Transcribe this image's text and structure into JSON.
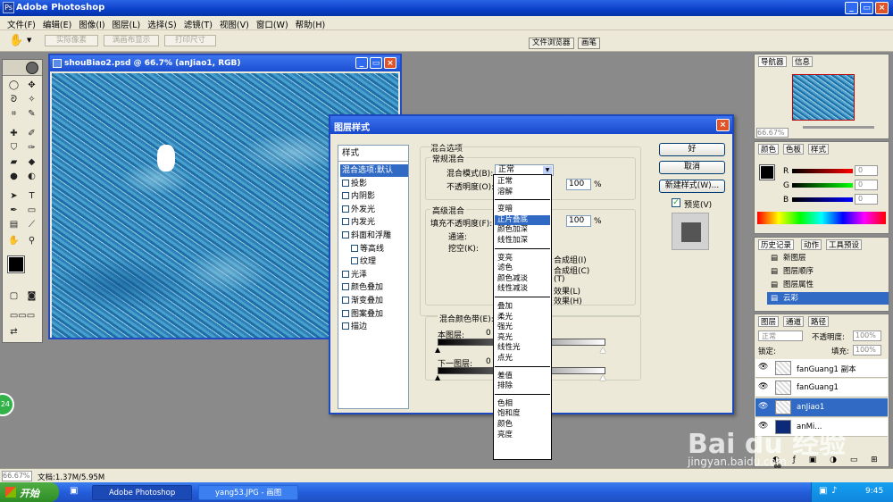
{
  "app": {
    "title": "Adobe Photoshop"
  },
  "menubar": [
    "文件(F)",
    "编辑(E)",
    "图像(I)",
    "图层(L)",
    "选择(S)",
    "滤镜(T)",
    "视图(V)",
    "窗口(W)",
    "帮助(H)"
  ],
  "options_bar": {
    "actual_pixels": "实际像素",
    "fit_screen": "满画布显示",
    "print_size": "打印尺寸",
    "file_browser_tab": "文件浏览器",
    "brushes_tab": "画笔"
  },
  "document": {
    "title": "shouBiao2.psd @ 66.7% (anJiao1, RGB)"
  },
  "dialog": {
    "title": "图层样式",
    "styles_header": "样式",
    "styles": [
      {
        "label": "混合选项:默认",
        "checkbox": false,
        "selected": true,
        "indent": false
      },
      {
        "label": "投影",
        "checkbox": true,
        "selected": false,
        "indent": false
      },
      {
        "label": "内阴影",
        "checkbox": true,
        "selected": false,
        "indent": false
      },
      {
        "label": "外发光",
        "checkbox": true,
        "selected": false,
        "indent": false
      },
      {
        "label": "内发光",
        "checkbox": true,
        "selected": false,
        "indent": false
      },
      {
        "label": "斜面和浮雕",
        "checkbox": true,
        "selected": false,
        "indent": false
      },
      {
        "label": "等高线",
        "checkbox": true,
        "selected": false,
        "indent": true
      },
      {
        "label": "纹理",
        "checkbox": true,
        "selected": false,
        "indent": true
      },
      {
        "label": "光泽",
        "checkbox": true,
        "selected": false,
        "indent": false
      },
      {
        "label": "颜色叠加",
        "checkbox": true,
        "selected": false,
        "indent": false
      },
      {
        "label": "渐变叠加",
        "checkbox": true,
        "selected": false,
        "indent": false
      },
      {
        "label": "图案叠加",
        "checkbox": true,
        "selected": false,
        "indent": false
      },
      {
        "label": "描边",
        "checkbox": true,
        "selected": false,
        "indent": false
      }
    ],
    "blend_options": {
      "group_title": "混合选项",
      "general_title": "常规混合",
      "mode_label": "混合模式(B):",
      "mode_value": "正常",
      "opacity_label": "不透明度(O):",
      "opacity_value": "100",
      "percent": "%",
      "advanced_title": "高级混合",
      "fill_opacity_label": "填充不透明度(F):",
      "fill_opacity_value": "100",
      "channels_label": "通道:",
      "knockout_label": "挖空(K):",
      "adv_options": [
        "合成组(I)",
        "合成组(C)",
        "(T)",
        "效果(L)",
        "效果(H)"
      ],
      "blend_if_label": "混合颜色带(E):",
      "this_layer_label": "本图层:",
      "this_layer_value": "0",
      "underlying_label": "下一图层:",
      "underlying_value": "0"
    },
    "buttons": {
      "ok": "好",
      "cancel": "取消",
      "new_style": "新建样式(W)...",
      "preview": "预览(V)"
    },
    "dropdown_groups": [
      [
        "正常",
        "溶解"
      ],
      [
        "变暗",
        "正片叠底",
        "颜色加深",
        "线性加深"
      ],
      [
        "变亮",
        "滤色",
        "颜色减淡",
        "线性减淡"
      ],
      [
        "叠加",
        "柔光",
        "强光",
        "亮光",
        "线性光",
        "点光"
      ],
      [
        "差值",
        "排除"
      ],
      [
        "色相",
        "饱和度",
        "颜色",
        "亮度"
      ]
    ],
    "dropdown_highlight": "正片叠底"
  },
  "navigator": {
    "tabs": [
      "导航器",
      "信息"
    ],
    "zoom": "66.67%"
  },
  "color_panel": {
    "tabs": [
      "颜色",
      "色板",
      "样式"
    ],
    "channels": [
      "R",
      "G",
      "B"
    ],
    "values": [
      "0",
      "0",
      "0"
    ]
  },
  "history_panel": {
    "tabs": [
      "历史记录",
      "动作",
      "工具预设"
    ],
    "items": [
      "新图层",
      "图层顺序",
      "图层属性",
      "云彩"
    ],
    "selected": "云彩"
  },
  "layers_panel": {
    "tabs": [
      "图层",
      "通道",
      "路径"
    ],
    "blend_mode": "正常",
    "opacity_label": "不透明度:",
    "opacity_value": "100%",
    "lock_label": "锁定:",
    "fill_label": "填充:",
    "fill_value": "100%",
    "layers": [
      {
        "name": "fanGuang1 副本",
        "selected": false
      },
      {
        "name": "fanGuang1",
        "selected": false
      },
      {
        "name": "anJiao1",
        "selected": true
      },
      {
        "name": "anMi...",
        "selected": false
      }
    ]
  },
  "statusbar": {
    "zoom": "66.67%",
    "doc": "文档:1.37M/5.95M"
  },
  "taskbar": {
    "start": "开始",
    "tasks": [
      "Adobe Photoshop",
      "yang53.JPG - 画图"
    ],
    "time": "9:45"
  },
  "badge": "24",
  "watermark": {
    "brand": "Bai du 经验",
    "url": "jingyan.baidu.com"
  },
  "colors": {
    "accent": "#316ac5",
    "titlebar": "#0a3fc8",
    "canvas_blue": "#2a86bd"
  }
}
